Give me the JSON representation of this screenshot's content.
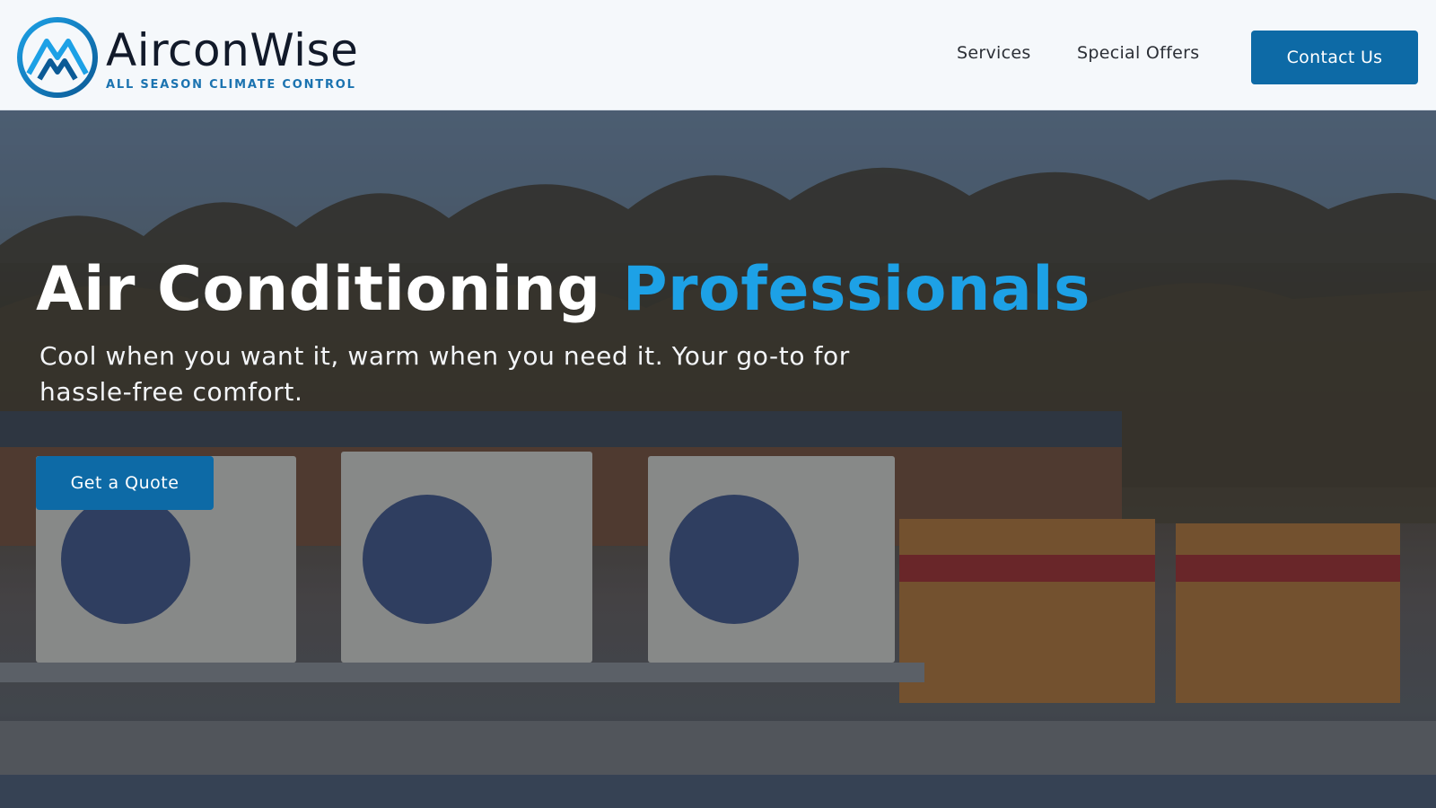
{
  "brand": {
    "name": "AirconWise",
    "tagline": "ALL SEASON CLIMATE CONTROL",
    "logo_icon": "mountain-snowflake-logo-icon"
  },
  "nav": {
    "services_label": "Services",
    "offers_label": "Special Offers",
    "contact_label": "Contact Us"
  },
  "hero": {
    "title_main": "Air Conditioning",
    "title_accent": "Professionals",
    "subtitle": "Cool when you want it, warm when you need it. Your go-to for hassle-free comfort.",
    "cta_label": "Get a Quote"
  },
  "colors": {
    "primary": "#0d6aa6",
    "accent": "#1da1e6",
    "header_bg": "#f5f8fb",
    "logo_text": "#121a2a"
  }
}
